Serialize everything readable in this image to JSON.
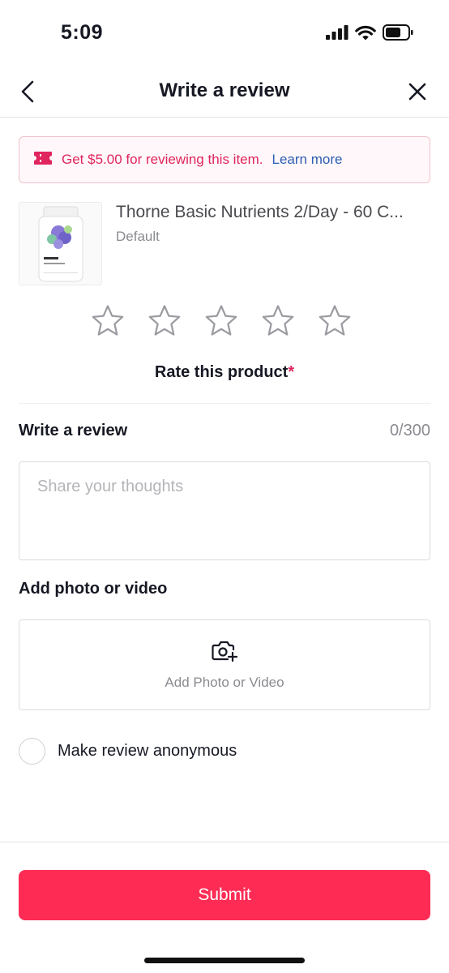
{
  "status_bar": {
    "time": "5:09",
    "icons": [
      "signal-icon",
      "wifi-icon",
      "battery-icon"
    ]
  },
  "nav": {
    "title": "Write a review",
    "back_icon": "chevron-left-icon",
    "close_icon": "close-icon"
  },
  "promo": {
    "icon": "coupon-icon",
    "text": "Get $5.00 for reviewing this item.",
    "link": "Learn more",
    "accent_color": "#e0245e",
    "link_color": "#2b5db3"
  },
  "product": {
    "name": "Thorne Basic Nutrients 2/Day - 60 C...",
    "variant": "Default",
    "thumbnail_brand": "THORNE"
  },
  "rating": {
    "stars": [
      {
        "name": "star-1-icon"
      },
      {
        "name": "star-2-icon"
      },
      {
        "name": "star-3-icon"
      },
      {
        "name": "star-4-icon"
      },
      {
        "name": "star-5-icon"
      }
    ],
    "selected": 0,
    "max": 5,
    "label": "Rate this product",
    "required_mark": "*"
  },
  "review": {
    "heading": "Write a review",
    "counter": "0/300",
    "value": "",
    "placeholder": "Share your thoughts"
  },
  "media": {
    "heading": "Add photo or video",
    "icon": "camera-add-icon",
    "label": "Add Photo or Video"
  },
  "anonymous": {
    "label": "Make review anonymous",
    "checked": false
  },
  "submit": {
    "label": "Submit",
    "color": "#fe2c55"
  }
}
